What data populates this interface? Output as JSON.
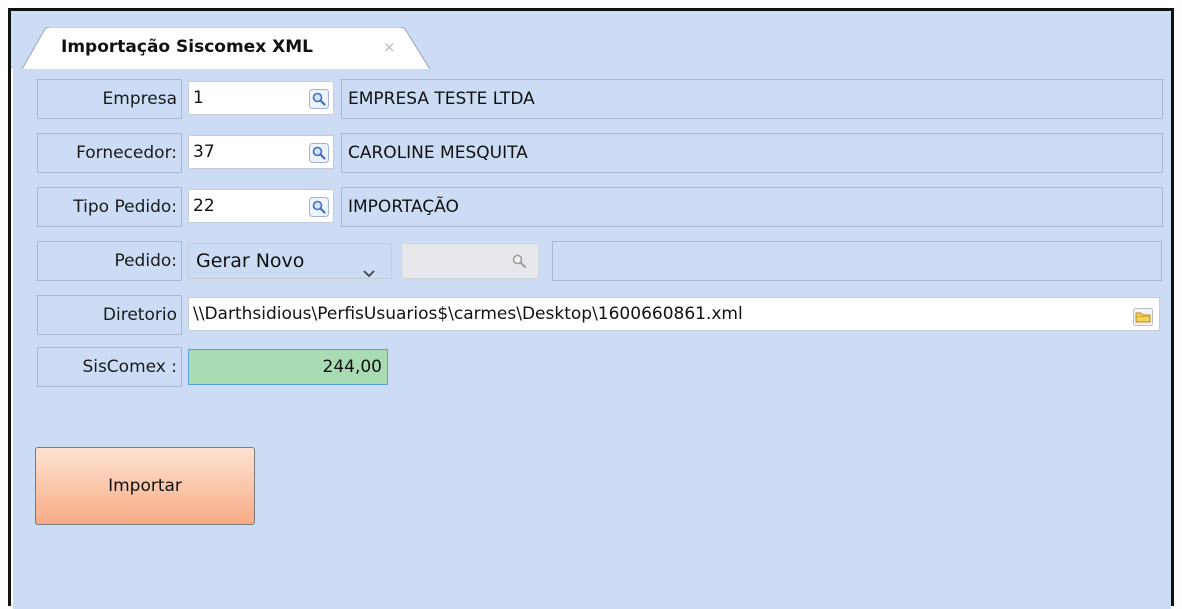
{
  "tab": {
    "title": "Importação Siscomex XML",
    "close_glyph": "×"
  },
  "form": {
    "empresa": {
      "label": "Empresa",
      "code": "1",
      "description": "EMPRESA TESTE LTDA"
    },
    "fornecedor": {
      "label": "Fornecedor:",
      "code": "37",
      "description": "CAROLINE MESQUITA"
    },
    "tipo_pedido": {
      "label": "Tipo Pedido:",
      "code": "22",
      "description": "IMPORTAÇÃO"
    },
    "pedido": {
      "label": "Pedido:",
      "selected": "Gerar Novo",
      "number": "",
      "description": ""
    },
    "diretorio": {
      "label": "Diretorio",
      "value": "\\\\Darthsidious\\PerfisUsuarios$\\carmes\\Desktop\\1600660861.xml"
    },
    "siscomex": {
      "label": "SisComex :",
      "value": "244,00"
    }
  },
  "actions": {
    "import_label": "Importar"
  },
  "icons": {
    "lookup": "search-icon",
    "dropdown": "chevron-down-icon",
    "folder": "folder-icon",
    "close": "close-icon"
  },
  "colors": {
    "panel_background": "#ccdcf5",
    "siscomex_background": "#a9dcb3",
    "import_button_top": "#fde3d2",
    "import_button_bottom": "#f7ab86"
  }
}
